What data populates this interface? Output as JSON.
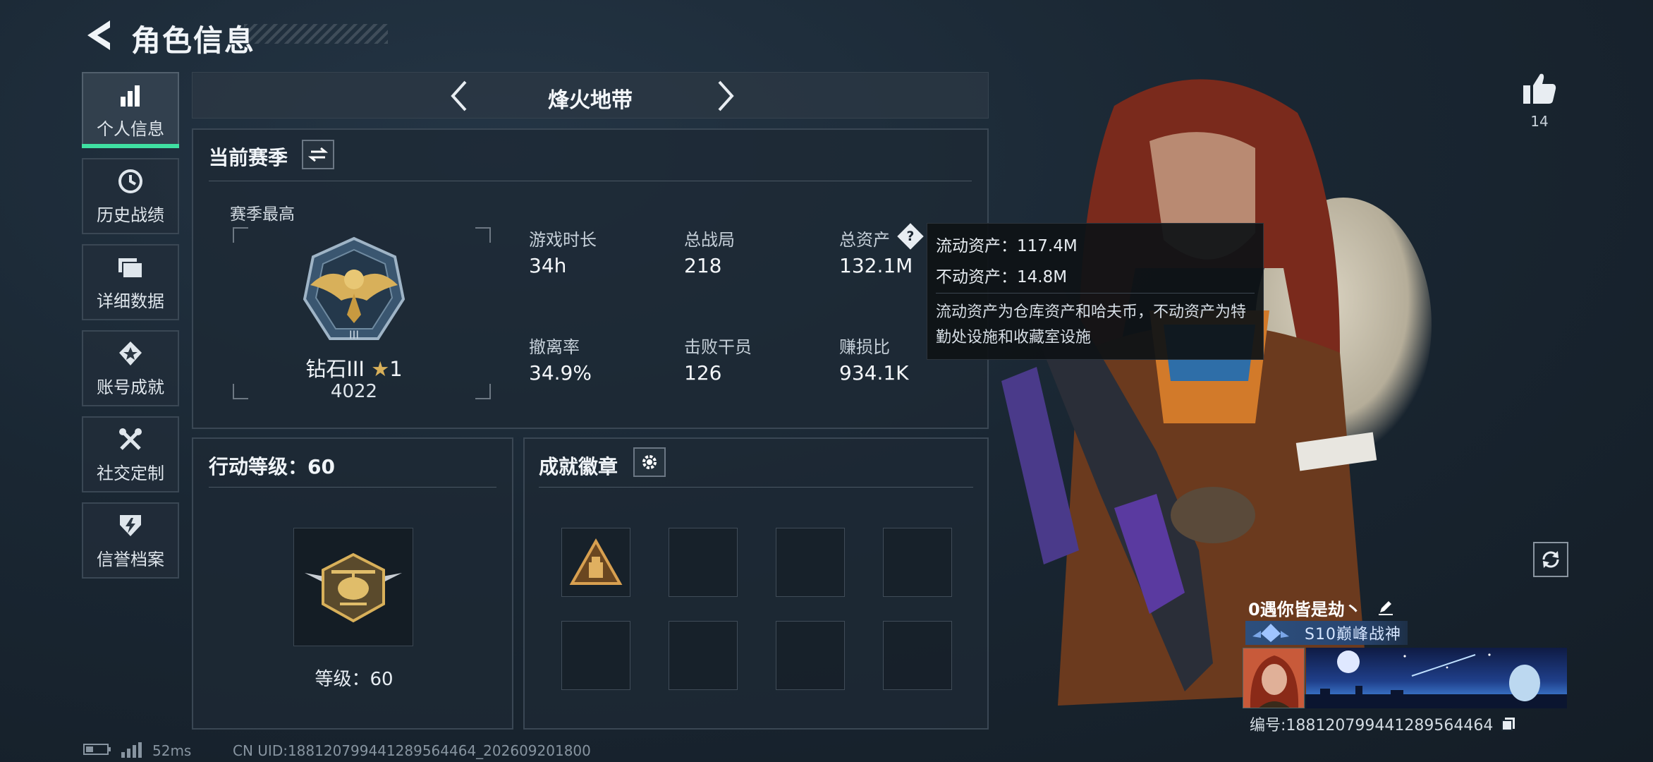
{
  "header": {
    "title": "角色信息",
    "back_icon": "back-arrow-icon"
  },
  "sidebar": {
    "items": [
      {
        "label": "个人信息",
        "icon": "bar-chart-icon",
        "active": true
      },
      {
        "label": "历史战绩",
        "icon": "clock-history-icon",
        "active": false
      },
      {
        "label": "详细数据",
        "icon": "folder-icon",
        "active": false
      },
      {
        "label": "账号成就",
        "icon": "medal-star-icon",
        "active": false
      },
      {
        "label": "社交定制",
        "icon": "tools-icon",
        "active": false
      },
      {
        "label": "信誉档案",
        "icon": "shield-lightning-icon",
        "active": false
      }
    ]
  },
  "mode": {
    "title": "烽火地带"
  },
  "season": {
    "heading": "当前赛季",
    "best_label": "赛季最高",
    "rank_name": "钻石III",
    "rank_stars": "1",
    "rank_points": "4022",
    "stats": [
      {
        "label": "游戏时长",
        "value": "34h"
      },
      {
        "label": "总战局",
        "value": "218"
      },
      {
        "label": "总资产",
        "value": "132.1M"
      },
      {
        "label": "撤离率",
        "value": "34.9%"
      },
      {
        "label": "击败干员",
        "value": "126"
      },
      {
        "label": "赚损比",
        "value": "934.1K"
      }
    ]
  },
  "tooltip": {
    "liquid": "流动资产：117.4M",
    "fixed": "不动资产：14.8M",
    "desc": "流动资产为仓库资产和哈夫币，不动资产为特勤处设施和收藏室设施"
  },
  "level": {
    "heading": "行动等级：60",
    "level_text": "等级：60"
  },
  "badges": {
    "heading": "成就徽章"
  },
  "profile": {
    "like_count": "14",
    "player_name": "0遇你皆是劫丶",
    "title_badge": "S10巅峰战神",
    "id_text": "编号:18812079944128956446​4"
  },
  "status": {
    "ping": "52ms",
    "uid": "CN UID:18812079944128956446​4_202609201800"
  },
  "colors": {
    "accent": "#3fe0a2",
    "gold": "#d8b05a",
    "panel": "#1e2934"
  }
}
